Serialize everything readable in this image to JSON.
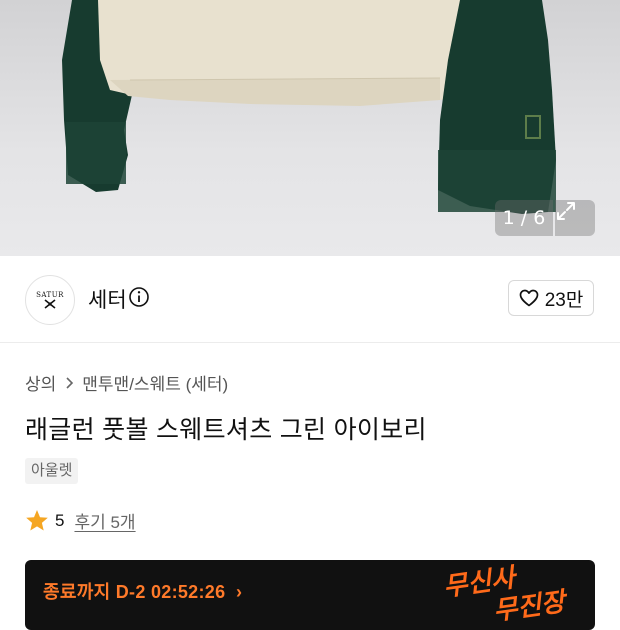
{
  "gallery": {
    "counter": "1 / 6"
  },
  "brand": {
    "logo_text": "SATUR",
    "name": "세터",
    "likes": "23만"
  },
  "breadcrumb": {
    "level1": "상의",
    "level2": "맨투맨/스웨트 (세터)"
  },
  "product": {
    "title": "래글런 풋볼 스웨트셔츠 그린 아이보리",
    "tag": "아울렛",
    "rating": "5",
    "reviews": "후기 5개"
  },
  "banner": {
    "countdown": "종료까지 D-2 02:52:26",
    "promo_line1": "무신사",
    "promo_line2": "무진장"
  },
  "colors": {
    "accent": "#ff7a2a",
    "star": "#f5a623",
    "sleeve": "#163a2e",
    "body": "#e8e1d0"
  }
}
